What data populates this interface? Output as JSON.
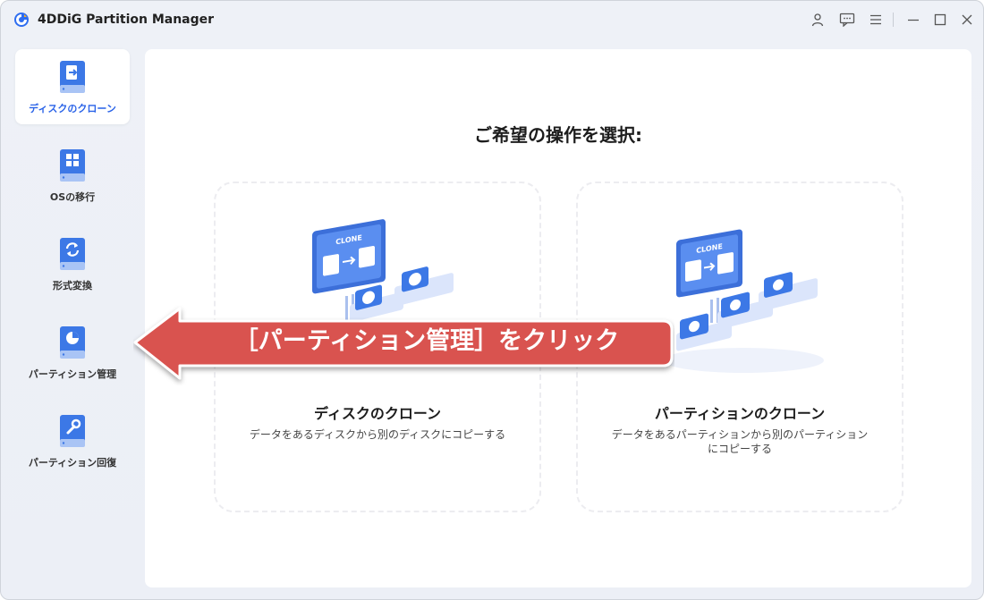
{
  "app": {
    "title": "4DDiG Partition Manager"
  },
  "titlebar": {
    "icons": [
      "user-icon",
      "feedback-icon",
      "menu-icon",
      "minimize-icon",
      "maximize-icon",
      "close-icon"
    ]
  },
  "sidebar": {
    "items": [
      {
        "label": "ディスクのクローン",
        "icon": "disk-clone-icon",
        "active": true
      },
      {
        "label": "OSの移行",
        "icon": "os-migration-icon",
        "active": false
      },
      {
        "label": "形式変換",
        "icon": "format-convert-icon",
        "active": false
      },
      {
        "label": "パーティション管理",
        "icon": "partition-management-icon",
        "active": false
      },
      {
        "label": "パーティション回復",
        "icon": "partition-recovery-icon",
        "active": false
      }
    ]
  },
  "main": {
    "heading": "ご希望の操作を選択:",
    "cards": [
      {
        "title": "ディスクのクローン",
        "desc": "データをあるディスクから別のディスクにコピーする",
        "screen_label": "CLONE"
      },
      {
        "title": "パーティションのクローン",
        "desc": "データをあるパーティションから別のパーティションにコピーする",
        "screen_label": "CLONE"
      }
    ]
  },
  "annotation": {
    "text": "［パーティション管理］をクリック",
    "color": "#d9534f"
  },
  "colors": {
    "accent": "#2a63e8",
    "icon_blue": "#3c78e6",
    "window_bg": "#eef1f7"
  }
}
